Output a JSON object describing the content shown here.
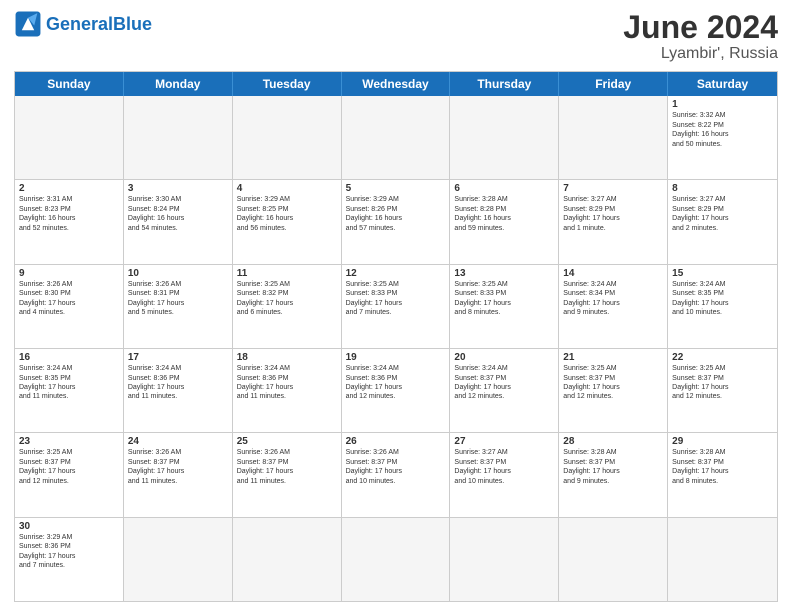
{
  "header": {
    "logo_general": "General",
    "logo_blue": "Blue",
    "month": "June 2024",
    "location": "Lyambir', Russia"
  },
  "days_of_week": [
    "Sunday",
    "Monday",
    "Tuesday",
    "Wednesday",
    "Thursday",
    "Friday",
    "Saturday"
  ],
  "weeks": [
    [
      {
        "day": "",
        "text": "",
        "empty": true
      },
      {
        "day": "",
        "text": "",
        "empty": true
      },
      {
        "day": "",
        "text": "",
        "empty": true
      },
      {
        "day": "",
        "text": "",
        "empty": true
      },
      {
        "day": "",
        "text": "",
        "empty": true
      },
      {
        "day": "",
        "text": "",
        "empty": true
      },
      {
        "day": "1",
        "text": "Sunrise: 3:32 AM\nSunset: 8:22 PM\nDaylight: 16 hours\nand 50 minutes.",
        "empty": false
      }
    ],
    [
      {
        "day": "2",
        "text": "Sunrise: 3:31 AM\nSunset: 8:23 PM\nDaylight: 16 hours\nand 52 minutes.",
        "empty": false
      },
      {
        "day": "3",
        "text": "Sunrise: 3:30 AM\nSunset: 8:24 PM\nDaylight: 16 hours\nand 54 minutes.",
        "empty": false
      },
      {
        "day": "4",
        "text": "Sunrise: 3:29 AM\nSunset: 8:25 PM\nDaylight: 16 hours\nand 56 minutes.",
        "empty": false
      },
      {
        "day": "5",
        "text": "Sunrise: 3:29 AM\nSunset: 8:26 PM\nDaylight: 16 hours\nand 57 minutes.",
        "empty": false
      },
      {
        "day": "6",
        "text": "Sunrise: 3:28 AM\nSunset: 8:28 PM\nDaylight: 16 hours\nand 59 minutes.",
        "empty": false
      },
      {
        "day": "7",
        "text": "Sunrise: 3:27 AM\nSunset: 8:29 PM\nDaylight: 17 hours\nand 1 minute.",
        "empty": false
      },
      {
        "day": "8",
        "text": "Sunrise: 3:27 AM\nSunset: 8:29 PM\nDaylight: 17 hours\nand 2 minutes.",
        "empty": false
      }
    ],
    [
      {
        "day": "9",
        "text": "Sunrise: 3:26 AM\nSunset: 8:30 PM\nDaylight: 17 hours\nand 4 minutes.",
        "empty": false
      },
      {
        "day": "10",
        "text": "Sunrise: 3:26 AM\nSunset: 8:31 PM\nDaylight: 17 hours\nand 5 minutes.",
        "empty": false
      },
      {
        "day": "11",
        "text": "Sunrise: 3:25 AM\nSunset: 8:32 PM\nDaylight: 17 hours\nand 6 minutes.",
        "empty": false
      },
      {
        "day": "12",
        "text": "Sunrise: 3:25 AM\nSunset: 8:33 PM\nDaylight: 17 hours\nand 7 minutes.",
        "empty": false
      },
      {
        "day": "13",
        "text": "Sunrise: 3:25 AM\nSunset: 8:33 PM\nDaylight: 17 hours\nand 8 minutes.",
        "empty": false
      },
      {
        "day": "14",
        "text": "Sunrise: 3:24 AM\nSunset: 8:34 PM\nDaylight: 17 hours\nand 9 minutes.",
        "empty": false
      },
      {
        "day": "15",
        "text": "Sunrise: 3:24 AM\nSunset: 8:35 PM\nDaylight: 17 hours\nand 10 minutes.",
        "empty": false
      }
    ],
    [
      {
        "day": "16",
        "text": "Sunrise: 3:24 AM\nSunset: 8:35 PM\nDaylight: 17 hours\nand 11 minutes.",
        "empty": false
      },
      {
        "day": "17",
        "text": "Sunrise: 3:24 AM\nSunset: 8:36 PM\nDaylight: 17 hours\nand 11 minutes.",
        "empty": false
      },
      {
        "day": "18",
        "text": "Sunrise: 3:24 AM\nSunset: 8:36 PM\nDaylight: 17 hours\nand 11 minutes.",
        "empty": false
      },
      {
        "day": "19",
        "text": "Sunrise: 3:24 AM\nSunset: 8:36 PM\nDaylight: 17 hours\nand 12 minutes.",
        "empty": false
      },
      {
        "day": "20",
        "text": "Sunrise: 3:24 AM\nSunset: 8:37 PM\nDaylight: 17 hours\nand 12 minutes.",
        "empty": false
      },
      {
        "day": "21",
        "text": "Sunrise: 3:25 AM\nSunset: 8:37 PM\nDaylight: 17 hours\nand 12 minutes.",
        "empty": false
      },
      {
        "day": "22",
        "text": "Sunrise: 3:25 AM\nSunset: 8:37 PM\nDaylight: 17 hours\nand 12 minutes.",
        "empty": false
      }
    ],
    [
      {
        "day": "23",
        "text": "Sunrise: 3:25 AM\nSunset: 8:37 PM\nDaylight: 17 hours\nand 12 minutes.",
        "empty": false
      },
      {
        "day": "24",
        "text": "Sunrise: 3:26 AM\nSunset: 8:37 PM\nDaylight: 17 hours\nand 11 minutes.",
        "empty": false
      },
      {
        "day": "25",
        "text": "Sunrise: 3:26 AM\nSunset: 8:37 PM\nDaylight: 17 hours\nand 11 minutes.",
        "empty": false
      },
      {
        "day": "26",
        "text": "Sunrise: 3:26 AM\nSunset: 8:37 PM\nDaylight: 17 hours\nand 10 minutes.",
        "empty": false
      },
      {
        "day": "27",
        "text": "Sunrise: 3:27 AM\nSunset: 8:37 PM\nDaylight: 17 hours\nand 10 minutes.",
        "empty": false
      },
      {
        "day": "28",
        "text": "Sunrise: 3:28 AM\nSunset: 8:37 PM\nDaylight: 17 hours\nand 9 minutes.",
        "empty": false
      },
      {
        "day": "29",
        "text": "Sunrise: 3:28 AM\nSunset: 8:37 PM\nDaylight: 17 hours\nand 8 minutes.",
        "empty": false
      }
    ],
    [
      {
        "day": "30",
        "text": "Sunrise: 3:29 AM\nSunset: 8:36 PM\nDaylight: 17 hours\nand 7 minutes.",
        "empty": false
      },
      {
        "day": "",
        "text": "",
        "empty": true
      },
      {
        "day": "",
        "text": "",
        "empty": true
      },
      {
        "day": "",
        "text": "",
        "empty": true
      },
      {
        "day": "",
        "text": "",
        "empty": true
      },
      {
        "day": "",
        "text": "",
        "empty": true
      },
      {
        "day": "",
        "text": "",
        "empty": true
      }
    ]
  ]
}
